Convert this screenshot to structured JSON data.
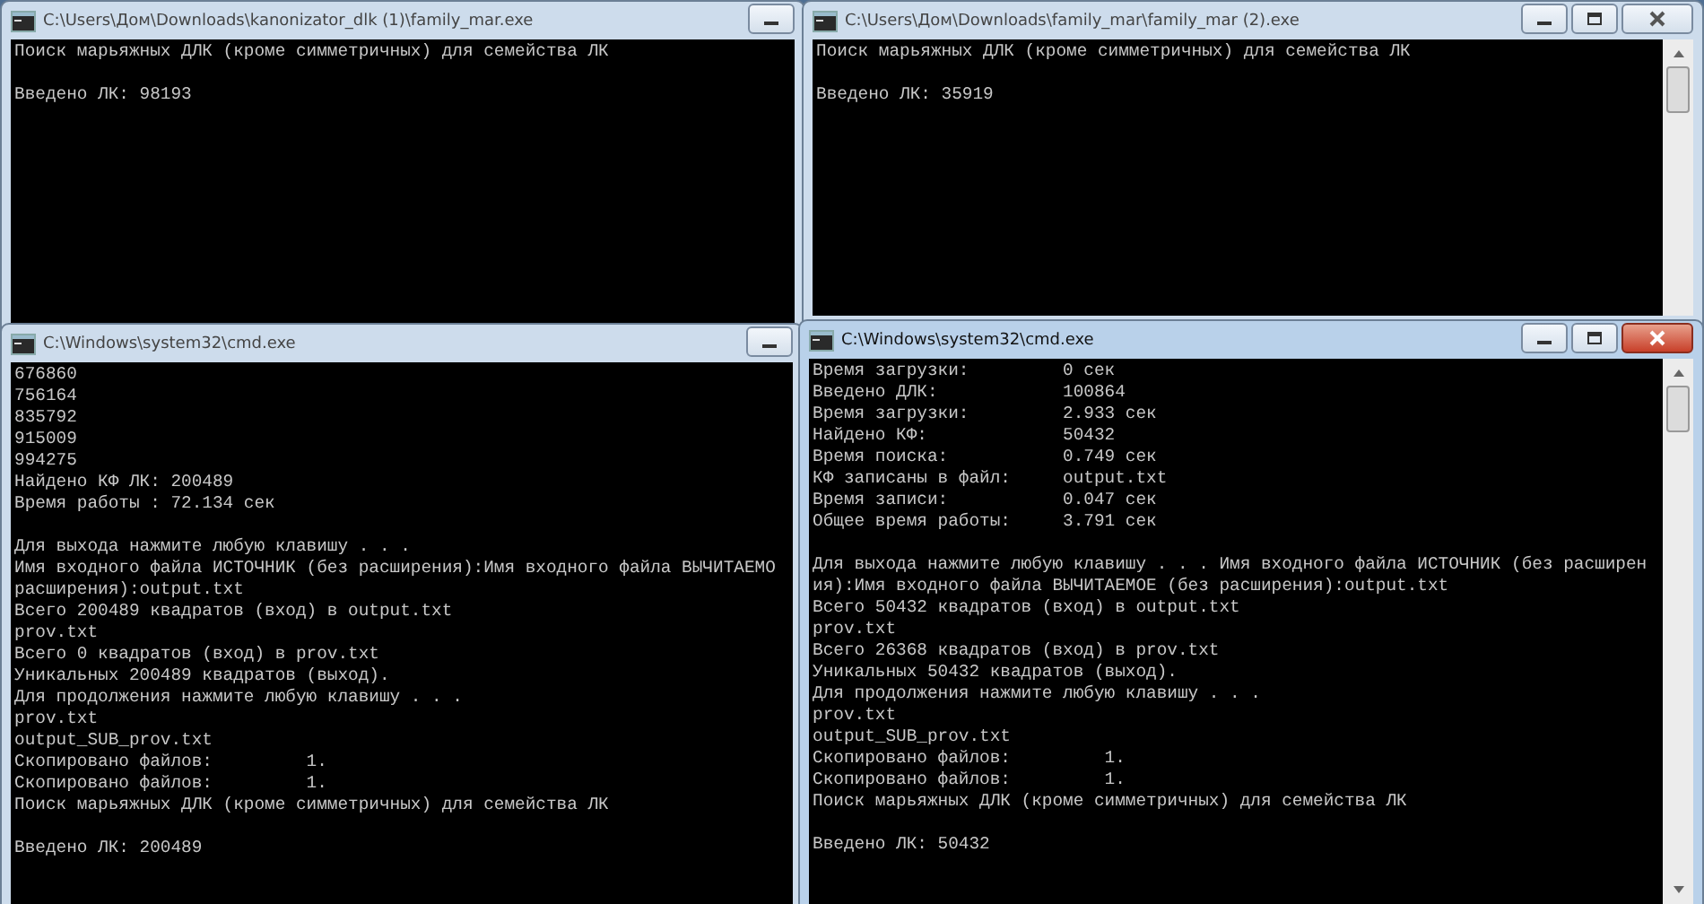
{
  "windows": [
    {
      "title": "C:\\Users\\Дом\\Downloads\\kanonizator_dlk (1)\\family_mar.exe",
      "active": false,
      "scrollbar": false,
      "buttons": [
        {
          "kind": "minimize"
        }
      ],
      "blocks": [
        [
          "Поиск марьяжных ДЛК (кроме симметричных) для семейства ЛК"
        ],
        [
          "Введено ЛК: 98193"
        ]
      ]
    },
    {
      "title": "C:\\Users\\Дом\\Downloads\\family_mar\\family_mar (2).exe",
      "active": false,
      "scrollbar": true,
      "buttons": [
        {
          "kind": "minimize"
        },
        {
          "kind": "maximize"
        },
        {
          "kind": "close"
        }
      ],
      "blocks": [
        [
          "Поиск марьяжных ДЛК (кроме симметричных) для семейства ЛК"
        ],
        [
          "Введено ЛК: 35919"
        ]
      ]
    },
    {
      "title": "C:\\Windows\\system32\\cmd.exe",
      "active": false,
      "scrollbar": false,
      "buttons": [
        {
          "kind": "minimize"
        }
      ],
      "blocks": [
        [
          "676860",
          "756164",
          "835792",
          "915009",
          "994275",
          "Найдено КФ ЛК: 200489",
          "Время работы : 72.134 сек"
        ],
        [
          "Для выхода нажмите любую клавишу . . .",
          "Имя входного файла ИСТОЧНИК (без расширения):Имя входного файла ВЫЧИТАЕМО",
          "расширения):output.txt",
          "Всего 200489 квадратов (вход) в output.txt",
          "prov.txt",
          "Всего 0 квадратов (вход) в prov.txt",
          "Уникальных 200489 квадратов (выход).",
          "Для продолжения нажмите любую клавишу . . .",
          "prov.txt",
          "output_SUB_prov.txt",
          "Скопировано файлов:         1.",
          "Скопировано файлов:         1.",
          "Поиск марьяжных ДЛК (кроме симметричных) для семейства ЛК"
        ],
        [
          "Введено ЛК: 200489"
        ]
      ]
    },
    {
      "title": "C:\\Windows\\system32\\cmd.exe",
      "active": true,
      "scrollbar": true,
      "buttons": [
        {
          "kind": "minimize"
        },
        {
          "kind": "maximize"
        },
        {
          "kind": "close"
        }
      ],
      "blocks": [
        [
          "Время загрузки:         0 сек",
          "Введено ДЛК:            100864",
          "Время загрузки:         2.933 сек",
          "Найдено КФ:             50432",
          "Время поиска:           0.749 сек",
          "КФ записаны в файл:     output.txt",
          "Время записи:           0.047 сек",
          "Общее время работы:     3.791 сек"
        ],
        [
          "Для выхода нажмите любую клавишу . . . Имя входного файла ИСТОЧНИК (без расширен",
          "ия):Имя входного файла ВЫЧИТАЕМОЕ (без расширения):output.txt",
          "Всего 50432 квадратов (вход) в output.txt",
          "prov.txt",
          "Всего 26368 квадратов (вход) в prov.txt",
          "Уникальных 50432 квадратов (выход).",
          "Для продолжения нажмите любую клавишу . . .",
          "prov.txt",
          "output_SUB_prov.txt",
          "Скопировано файлов:         1.",
          "Скопировано файлов:         1.",
          "Поиск марьяжных ДЛК (кроме симметричных) для семейства ЛК"
        ],
        [
          "Введено ЛК: 50432"
        ]
      ]
    }
  ]
}
